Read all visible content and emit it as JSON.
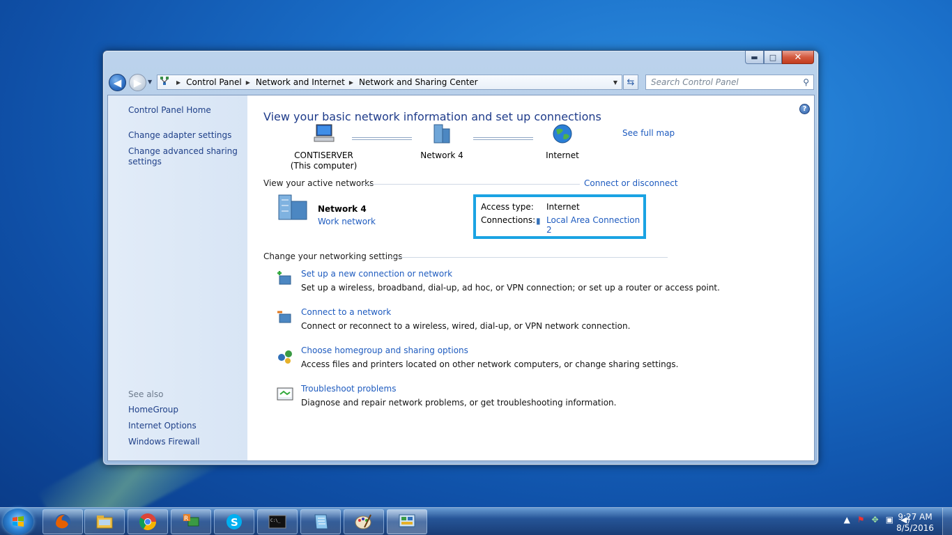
{
  "window": {
    "caption": {
      "minimize": "▬",
      "maximize": "□",
      "close": "✕"
    }
  },
  "navigation": {
    "back": "◀",
    "forward": "▶",
    "history": "▼",
    "breadcrumbs": [
      "Control Panel",
      "Network and Internet",
      "Network and Sharing Center"
    ],
    "search_placeholder": "Search Control Panel"
  },
  "left_pane": {
    "home": "Control Panel Home",
    "links": [
      "Change adapter settings",
      "Change advanced sharing settings"
    ],
    "see_also_title": "See also",
    "see_also": [
      "HomeGroup",
      "Internet Options",
      "Windows Firewall"
    ]
  },
  "main": {
    "title": "View your basic network information and set up connections",
    "see_full_map": "See full map",
    "map": {
      "computer_name": "CONTISERVER",
      "computer_sub": "(This computer)",
      "network": "Network  4",
      "internet": "Internet"
    },
    "active_networks": {
      "heading": "View your active networks",
      "connect_disconnect": "Connect or disconnect",
      "network_name": "Network  4",
      "network_type": "Work network",
      "access_type_label": "Access type:",
      "access_type_value": "Internet",
      "connections_label": "Connections:",
      "connections_value": "Local Area Connection 2"
    },
    "change_settings": {
      "heading": "Change your networking settings",
      "tasks": [
        {
          "link": "Set up a new connection or network",
          "desc": "Set up a wireless, broadband, dial-up, ad hoc, or VPN connection; or set up a router or access point."
        },
        {
          "link": "Connect to a network",
          "desc": "Connect or reconnect to a wireless, wired, dial-up, or VPN network connection."
        },
        {
          "link": "Choose homegroup and sharing options",
          "desc": "Access files and printers located on other network computers, or change sharing settings."
        },
        {
          "link": "Troubleshoot problems",
          "desc": "Diagnose and repair network problems, or get troubleshooting information."
        }
      ]
    }
  },
  "taskbar": {
    "pinned": [
      "firefox-icon",
      "explorer-icon",
      "chrome-icon",
      "remote-app-icon",
      "skype-icon",
      "cmd-icon",
      "notepad-icon",
      "paint-icon",
      "control-panel-icon"
    ],
    "cmd_text": "C:\\_",
    "clock_time": "9:27 AM",
    "clock_date": "8/5/2016"
  },
  "colors": {
    "link": "#1e5bbf",
    "title": "#1e3b8a",
    "highlight_border": "#1aa3e3",
    "left_pane_bg": "#dce8f6"
  }
}
